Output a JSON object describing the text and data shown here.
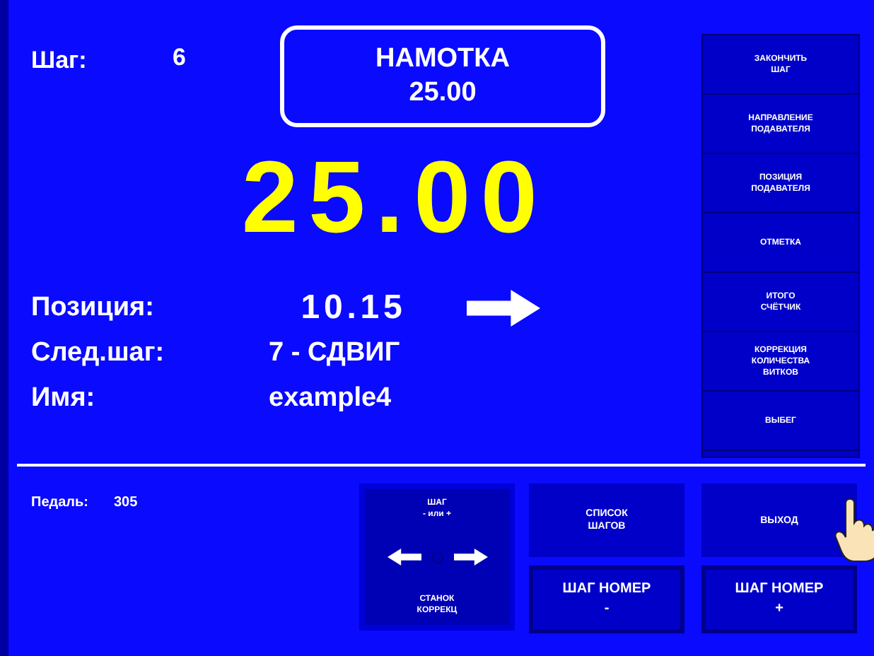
{
  "step": {
    "label": "Шаг:",
    "value": "6"
  },
  "mode": {
    "title": "НАМОТКА",
    "value": "25.00"
  },
  "big_value": "25.00",
  "info_rows": [
    {
      "label": "Позиция:",
      "value": "10.15",
      "kind": "arrow"
    },
    {
      "label": "След.шаг:",
      "value": "7 - СДВИГ",
      "kind": "plain"
    },
    {
      "label": "Имя:",
      "value": "example4",
      "kind": "plain"
    }
  ],
  "side_buttons": [
    "ЗАКОНЧИТЬ\nШАГ",
    "НАПРАВЛЕНИЕ\nПОДАВАТЕЛЯ",
    "ПОЗИЦИЯ\nПОДАВАТЕЛЯ",
    "ОТМЕТКА",
    "ИТОГО\nСЧЁТЧИК",
    "КОРРЕКЦИЯ\nКОЛИЧЕСТВА\nВИТКОВ",
    "ВЫБЕГ"
  ],
  "pedal": {
    "label": "Педаль:",
    "value": "305"
  },
  "jog_pad": {
    "top": "ШАГ\n- или +",
    "bottom": "СТАНОК\nКОРРЕКЦ"
  },
  "bottom_buttons": [
    {
      "label": "СПИСОК\nШАГОВ",
      "kind": "small"
    },
    {
      "label": "ВЫХОД",
      "kind": "small"
    },
    {
      "label": "ШАГ НОМЕР\n-",
      "kind": "large"
    },
    {
      "label": "ШАГ НОМЕР\n+",
      "kind": "large"
    }
  ]
}
